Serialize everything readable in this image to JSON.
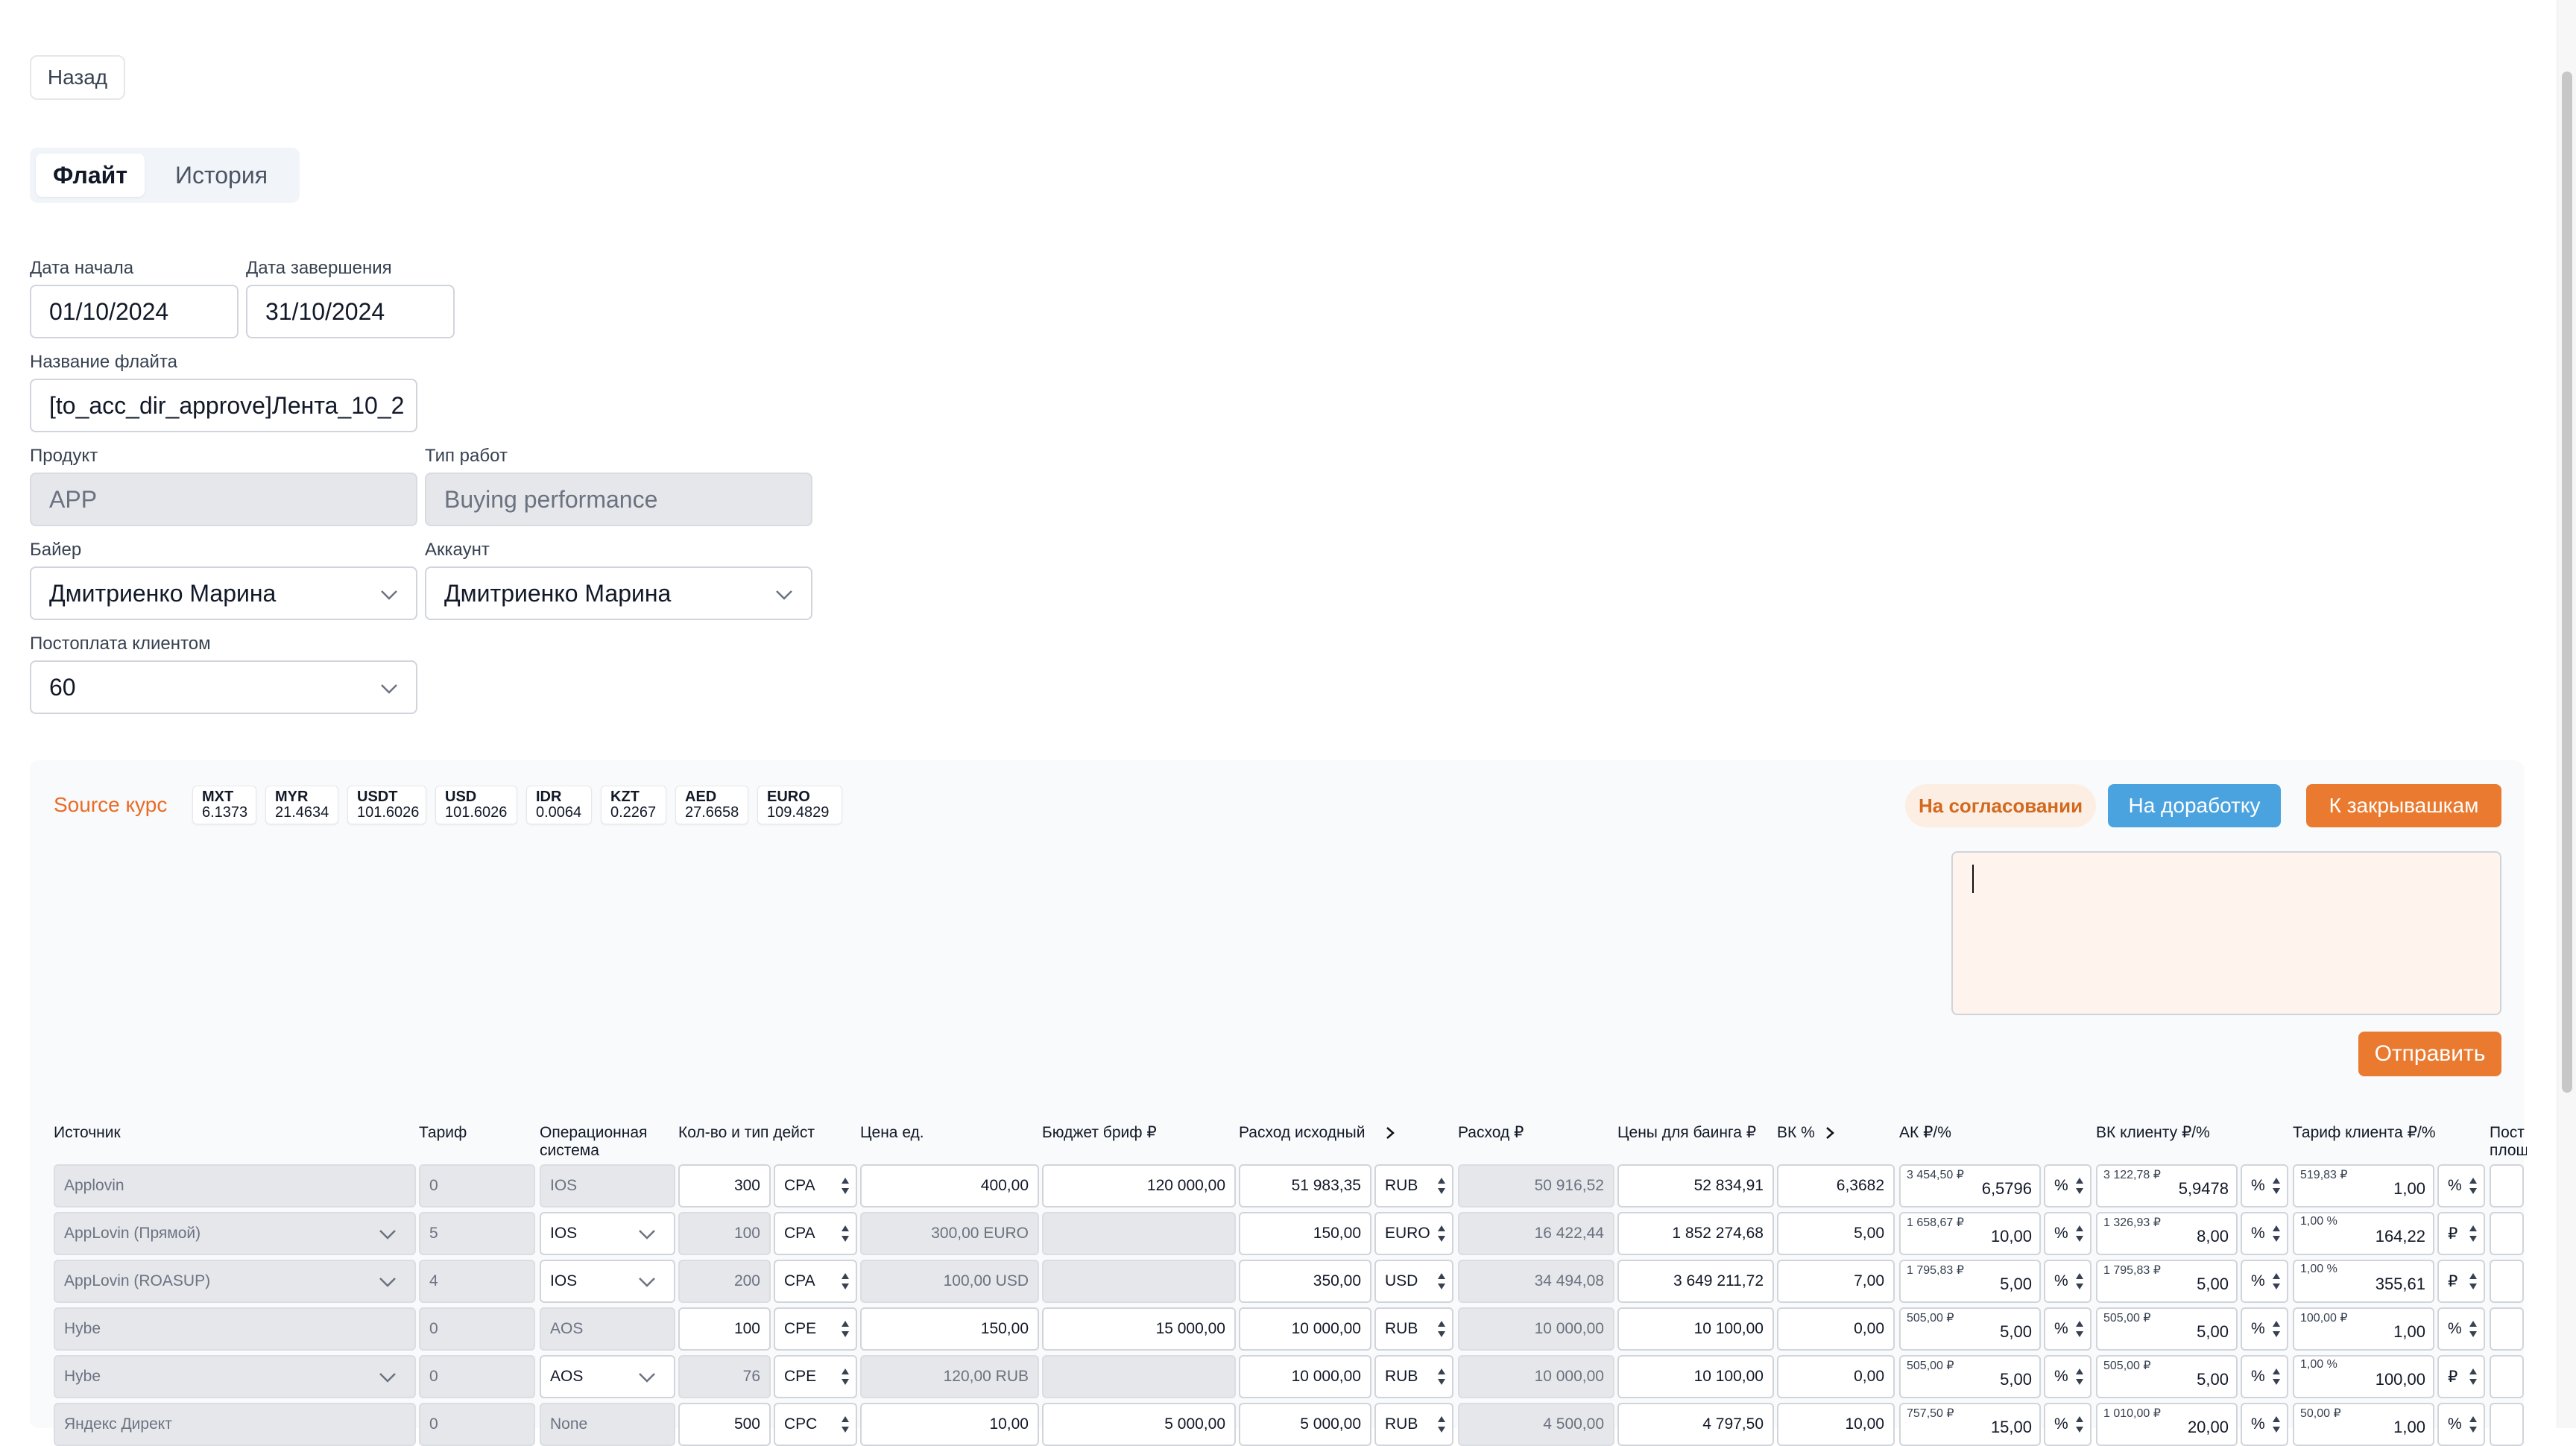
{
  "back_label": "Назад",
  "tabs": [
    {
      "label": "Флайт",
      "active": true
    },
    {
      "label": "История",
      "active": false
    }
  ],
  "form": {
    "start_date_label": "Дата начала",
    "start_date": "01/10/2024",
    "end_date_label": "Дата завершения",
    "end_date": "31/10/2024",
    "flight_name_label": "Название флайта",
    "flight_name": "[to_acc_dir_approve]Лента_10_2",
    "product_label": "Продукт",
    "product": "APP",
    "work_type_label": "Тип работ",
    "work_type": "Buying performance",
    "buyer_label": "Байер",
    "buyer": "Дмитриенко Марина",
    "account_label": "Аккаунт",
    "account": "Дмитриенко Марина",
    "postpay_label": "Постоплата клиентом",
    "postpay": "60"
  },
  "rates": {
    "label": "Source курс",
    "items": [
      {
        "code": "MXT",
        "value": "6.1373"
      },
      {
        "code": "MYR",
        "value": "21.4634"
      },
      {
        "code": "USDT",
        "value": "101.6026"
      },
      {
        "code": "USD",
        "value": "101.6026"
      },
      {
        "code": "IDR",
        "value": "0.0064"
      },
      {
        "code": "KZT",
        "value": "0.2267"
      },
      {
        "code": "AED",
        "value": "27.6658"
      },
      {
        "code": "EURO",
        "value": "109.4829"
      }
    ]
  },
  "actions": {
    "status": "На согласовании",
    "rework": "На доработку",
    "to_closing": "К закрывашкам",
    "send": "Отправить",
    "comment": ""
  },
  "table": {
    "headers": {
      "source": "Источник",
      "tariff": "Тариф",
      "os": "Операционная система",
      "qty": "Кол-во и тип дейст",
      "unit_price": "Цена ед.",
      "budget": "Бюджет бриф ₽",
      "spend_orig": "Расход исходный",
      "spend": "Расход ₽",
      "buying_price": "Цены для баинга ₽",
      "vk": "ВК %",
      "ak": "АК ₽/%",
      "vk_client": "ВК клиенту ₽/%",
      "client_tariff": "Тариф клиента ₽/%",
      "post": "Пост площ"
    },
    "rows": [
      {
        "source": "Applovin",
        "tariff": "0",
        "os": "IOS",
        "qty": "300",
        "action": "CPA",
        "unit_price": "400,00",
        "budget": "120 000,00",
        "spend_orig": "51 983,35",
        "currency": "RUB",
        "spend": "50 916,52",
        "buying_price": "52 834,91",
        "vk": "6,3682",
        "ak_sum": "3 454,50 ₽",
        "ak_val": "6,5796",
        "ak_unit": "%",
        "vkc_sum": "3 122,78 ₽",
        "vkc_val": "5,9478",
        "vkc_unit": "%",
        "ct_sum": "519,83 ₽",
        "ct_val": "1,00",
        "ct_unit": "%"
      },
      {
        "source": "AppLovin (Прямой)",
        "tariff": "5",
        "os": "IOS",
        "qty": "100",
        "action": "CPA",
        "unit_price": "300,00 EURO",
        "budget": "",
        "spend_orig": "150,00",
        "currency": "EURO",
        "spend": "16 422,44",
        "buying_price": "1 852 274,68",
        "vk": "5,00",
        "ak_sum": "1 658,67 ₽",
        "ak_val": "10,00",
        "ak_unit": "%",
        "vkc_sum": "1 326,93 ₽",
        "vkc_val": "8,00",
        "vkc_unit": "%",
        "ct_sum": "1,00 %",
        "ct_val": "164,22",
        "ct_unit": "₽"
      },
      {
        "source": "AppLovin (ROASUP)",
        "tariff": "4",
        "os": "IOS",
        "qty": "200",
        "action": "CPA",
        "unit_price": "100,00 USD",
        "budget": "",
        "spend_orig": "350,00",
        "currency": "USD",
        "spend": "34 494,08",
        "buying_price": "3 649 211,72",
        "vk": "7,00",
        "ak_sum": "1 795,83 ₽",
        "ak_val": "5,00",
        "ak_unit": "%",
        "vkc_sum": "1 795,83 ₽",
        "vkc_val": "5,00",
        "vkc_unit": "%",
        "ct_sum": "1,00 %",
        "ct_val": "355,61",
        "ct_unit": "₽"
      },
      {
        "source": "Hybe",
        "tariff": "0",
        "os": "AOS",
        "qty": "100",
        "action": "CPE",
        "unit_price": "150,00",
        "budget": "15 000,00",
        "spend_orig": "10 000,00",
        "currency": "RUB",
        "spend": "10 000,00",
        "buying_price": "10 100,00",
        "vk": "0,00",
        "ak_sum": "505,00 ₽",
        "ak_val": "5,00",
        "ak_unit": "%",
        "vkc_sum": "505,00 ₽",
        "vkc_val": "5,00",
        "vkc_unit": "%",
        "ct_sum": "100,00 ₽",
        "ct_val": "1,00",
        "ct_unit": "%"
      },
      {
        "source": "Hybe",
        "tariff": "0",
        "os": "AOS",
        "qty": "76",
        "action": "CPE",
        "unit_price": "120,00 RUB",
        "budget": "",
        "spend_orig": "10 000,00",
        "currency": "RUB",
        "spend": "10 000,00",
        "buying_price": "10 100,00",
        "vk": "0,00",
        "ak_sum": "505,00 ₽",
        "ak_val": "5,00",
        "ak_unit": "%",
        "vkc_sum": "505,00 ₽",
        "vkc_val": "5,00",
        "vkc_unit": "%",
        "ct_sum": "1,00 %",
        "ct_val": "100,00",
        "ct_unit": "₽"
      },
      {
        "source": "Яндекс Директ",
        "tariff": "0",
        "os": "None",
        "qty": "500",
        "action": "CPC",
        "unit_price": "10,00",
        "budget": "5 000,00",
        "spend_orig": "5 000,00",
        "currency": "RUB",
        "spend": "4 500,00",
        "buying_price": "4 797,50",
        "vk": "10,00",
        "ak_sum": "757,50 ₽",
        "ak_val": "15,00",
        "ak_unit": "%",
        "vkc_sum": "1 010,00 ₽",
        "vkc_val": "20,00",
        "vkc_unit": "%",
        "ct_sum": "50,00 ₽",
        "ct_val": "1,00",
        "ct_unit": "%"
      }
    ]
  }
}
